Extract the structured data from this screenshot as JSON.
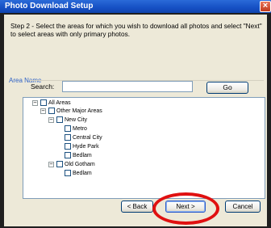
{
  "window": {
    "title": "Photo Download Setup",
    "close_glyph": "×"
  },
  "instruction": "Step 2 - Select the areas for which you wish to download all photos and select \"Next\" to select areas with only primary photos.",
  "group_label": "Area Name",
  "search": {
    "label": "Search:",
    "value": "",
    "placeholder": "",
    "go_label": "Go"
  },
  "tree": {
    "expander_glyph": "−",
    "nodes": [
      {
        "label": "All Areas",
        "expanded": true,
        "checked": false
      },
      {
        "label": "Other Major Areas",
        "expanded": true,
        "checked": false
      },
      {
        "label": "New City",
        "expanded": true,
        "checked": false
      },
      {
        "label": "Metro",
        "checked": false
      },
      {
        "label": "Central City",
        "checked": false
      },
      {
        "label": "Hyde Park",
        "checked": false
      },
      {
        "label": "Bedlam",
        "checked": false
      },
      {
        "label": "Old Gotham",
        "expanded": true,
        "checked": false
      },
      {
        "label": "Bedlam",
        "checked": false
      }
    ]
  },
  "buttons": {
    "back": "< Back",
    "next": "Next >",
    "cancel": "Cancel"
  },
  "colors": {
    "titlebar": "#1650c4",
    "group_label": "#2f62c6",
    "annotation_ring": "#e01010"
  }
}
